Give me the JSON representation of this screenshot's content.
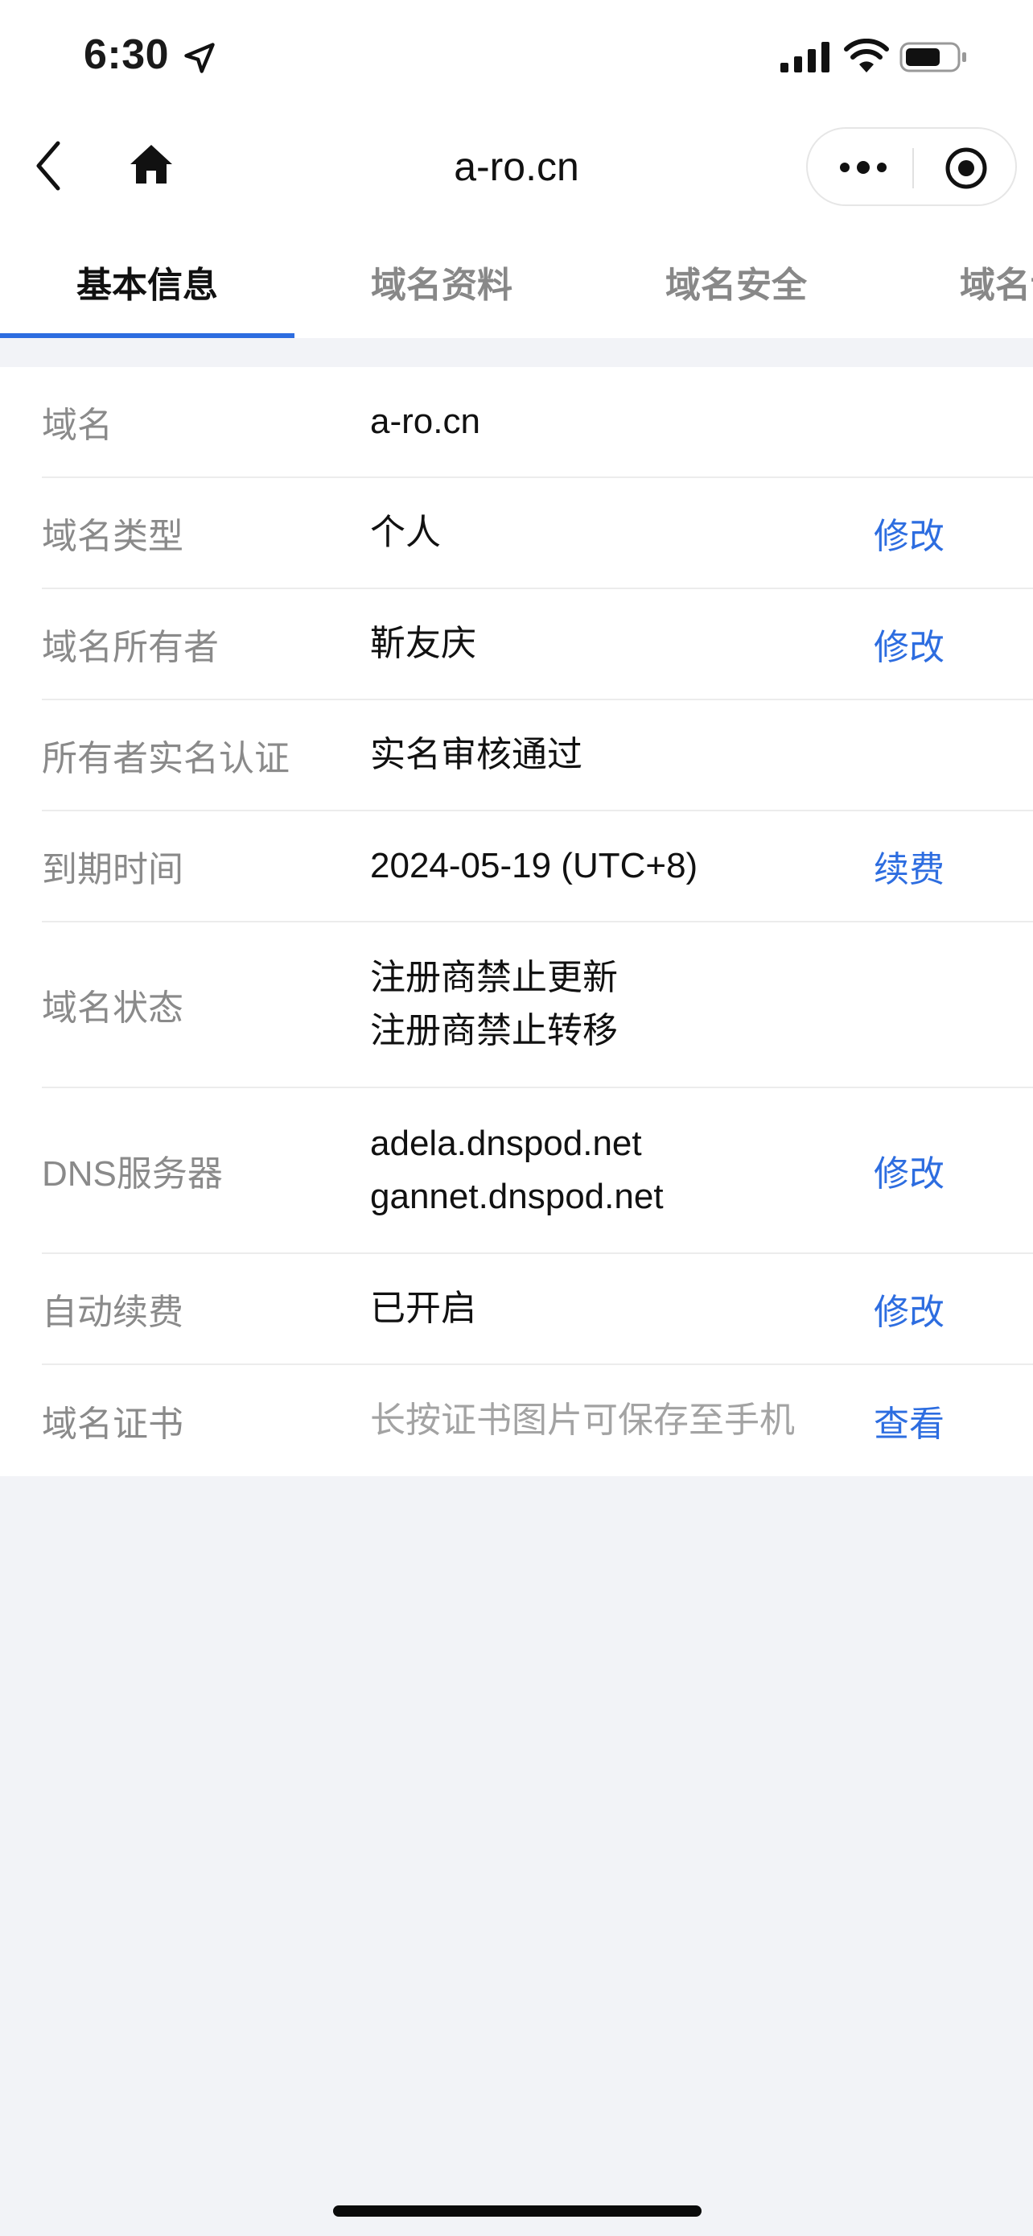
{
  "status_bar": {
    "time": "6:30"
  },
  "nav": {
    "title": "a-ro.cn"
  },
  "tabs": [
    {
      "label": "基本信息",
      "active": true
    },
    {
      "label": "域名资料",
      "active": false
    },
    {
      "label": "域名安全",
      "active": false
    },
    {
      "label": "域名设置",
      "active": false
    }
  ],
  "info": {
    "domain": {
      "label": "域名",
      "value": "a-ro.cn"
    },
    "type": {
      "label": "域名类型",
      "value": "个人",
      "action": "修改"
    },
    "owner": {
      "label": "域名所有者",
      "value": "靳友庆",
      "action": "修改"
    },
    "verification": {
      "label": "所有者实名认证",
      "value": "实名审核通过"
    },
    "expiry": {
      "label": "到期时间",
      "value": "2024-05-19 (UTC+8)",
      "action": "续费"
    },
    "status": {
      "label": "域名状态",
      "values": [
        "注册商禁止更新",
        "注册商禁止转移"
      ]
    },
    "dns": {
      "label": "DNS服务器",
      "values": [
        "adela.dnspod.net",
        "gannet.dnspod.net"
      ],
      "action": "修改"
    },
    "auto_renew": {
      "label": "自动续费",
      "value": "已开启",
      "action": "修改"
    },
    "certificate": {
      "label": "域名证书",
      "value": "长按证书图片可保存至手机",
      "action": "查看"
    }
  },
  "colors": {
    "accent": "#2d6de0",
    "background": "#f2f3f7"
  }
}
